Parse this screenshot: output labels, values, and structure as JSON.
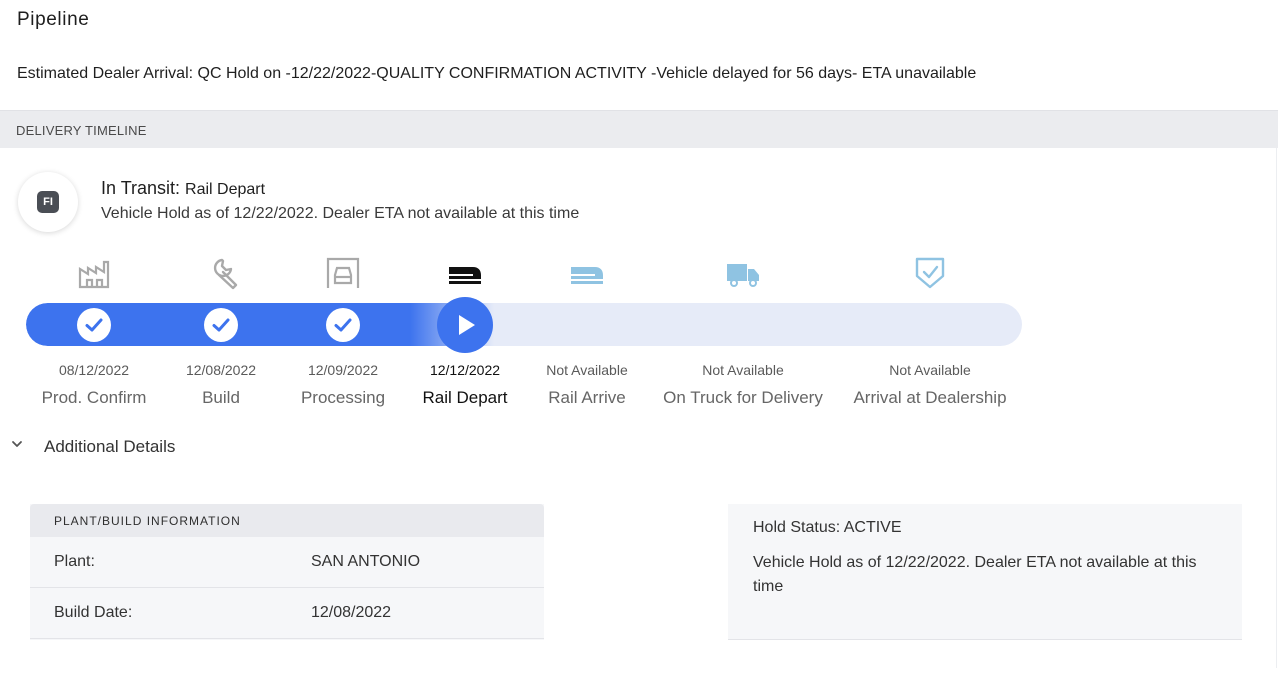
{
  "page": {
    "title": "Pipeline",
    "eta_line": "Estimated Dealer Arrival: QC Hold on -12/22/2022-QUALITY CONFIRMATION ACTIVITY -Vehicle delayed for 56 days- ETA unavailable"
  },
  "timeline": {
    "section_title": "DELIVERY TIMELINE",
    "badge": "FI",
    "status_prefix": "In Transit:",
    "status_stage": "Rail Depart",
    "status_message": "Vehicle Hold as of 12/22/2022. Dealer ETA not available at this time",
    "progress_fraction": 0.47,
    "steps": [
      {
        "label": "Prod. Confirm",
        "date": "08/12/2022",
        "state": "complete",
        "icon": "factory-icon"
      },
      {
        "label": "Build",
        "date": "12/08/2022",
        "state": "complete",
        "icon": "wrench-icon"
      },
      {
        "label": "Processing",
        "date": "12/09/2022",
        "state": "complete",
        "icon": "vehicle-processing-icon"
      },
      {
        "label": "Rail Depart",
        "date": "12/12/2022",
        "state": "current",
        "icon": "rail-car-icon"
      },
      {
        "label": "Rail Arrive",
        "date": "Not Available",
        "state": "pending",
        "icon": "rail-car-icon"
      },
      {
        "label": "On Truck for Delivery",
        "date": "Not Available",
        "state": "pending",
        "icon": "truck-icon"
      },
      {
        "label": "Arrival at Dealership",
        "date": "Not Available",
        "state": "pending",
        "icon": "shield-check-icon"
      }
    ]
  },
  "details": {
    "toggle_label": "Additional Details",
    "plant_card": {
      "title": "PLANT/BUILD INFORMATION",
      "rows": [
        {
          "key": "Plant:",
          "value": "SAN ANTONIO"
        },
        {
          "key": "Build Date:",
          "value": "12/08/2022"
        }
      ]
    },
    "hold_card": {
      "status": "Hold Status: ACTIVE",
      "message": "Vehicle Hold as of 12/22/2022. Dealer ETA not available at this time"
    }
  },
  "colors": {
    "accent": "#3d73ee",
    "track_background": "#e6ebf8",
    "done_icon": "#a9a9a9",
    "pending_icon": "#8fc3e2",
    "current_icon": "#111111"
  }
}
